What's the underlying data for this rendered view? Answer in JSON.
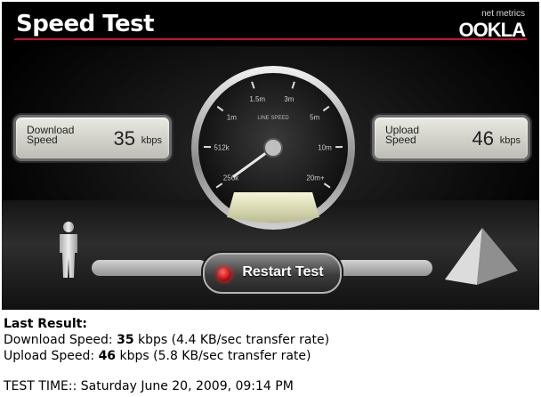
{
  "header": {
    "title": "Speed Test",
    "logo_small": "net metrics",
    "logo_main": "OOKLA"
  },
  "download": {
    "label_line1": "Download",
    "label_line2": "Speed",
    "value": "35",
    "unit": "kbps"
  },
  "upload": {
    "label_line1": "Upload",
    "label_line2": "Speed",
    "value": "46",
    "unit": "kbps"
  },
  "gauge": {
    "center_label": "LINE SPEED",
    "ticks": [
      "256k",
      "512k",
      "1m",
      "1.5m",
      "3m",
      "5m",
      "10m",
      "20m+"
    ],
    "needle_value": "46 kbps"
  },
  "restart_label": "Restart Test",
  "results": {
    "heading": "Last Result:",
    "download_prefix": "Download Speed: ",
    "download_value": "35",
    "download_suffix": " kbps (4.4 KB/sec transfer rate)",
    "upload_prefix": "Upload Speed: ",
    "upload_value": "46",
    "upload_suffix": " kbps (5.8 KB/sec transfer rate)",
    "test_time": "TEST TIME:: Saturday June 20, 2009, 09:14 PM"
  },
  "colors": {
    "accent_rule": "#c8102e",
    "restart_dot": "#e00000",
    "panel_bg": "#d9d9d2"
  },
  "icons": {
    "person": "person-icon",
    "server": "pyramid-server-icon"
  }
}
